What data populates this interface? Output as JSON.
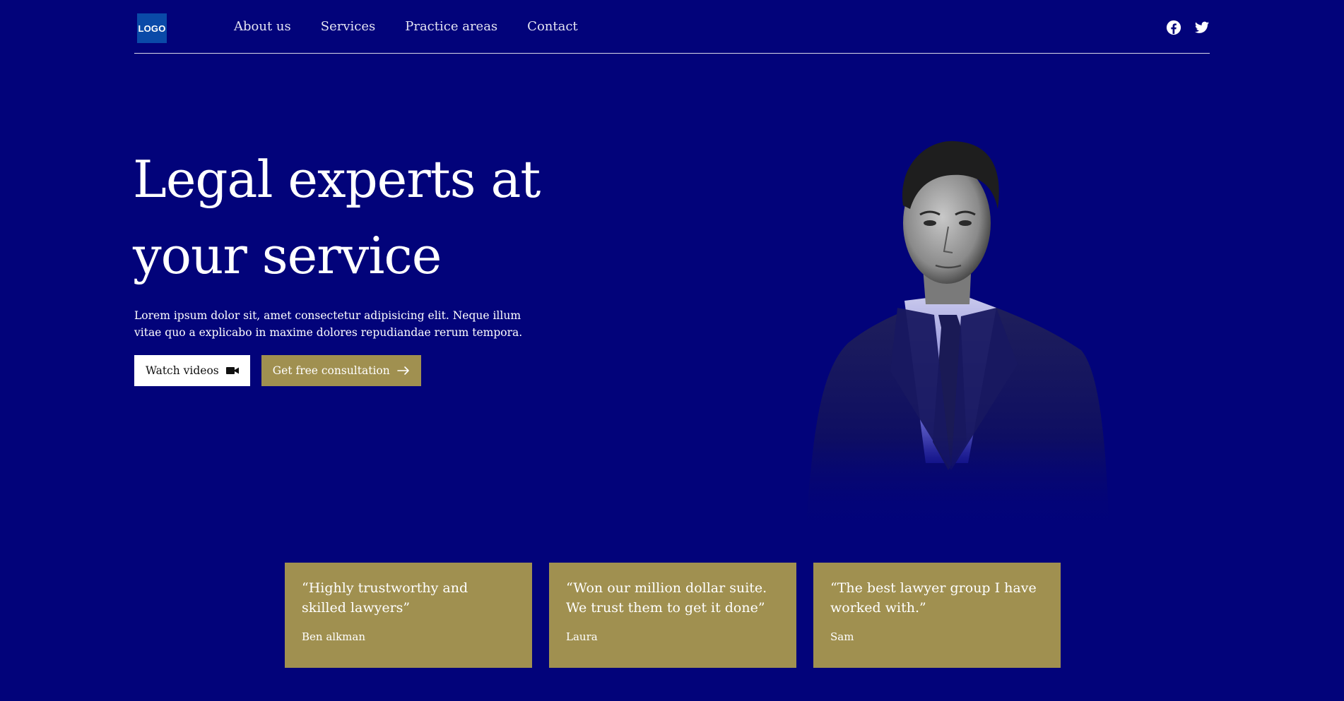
{
  "header": {
    "logo_text": "LOGO",
    "nav": [
      {
        "label": "About us"
      },
      {
        "label": "Services"
      },
      {
        "label": "Practice areas"
      },
      {
        "label": "Contact"
      }
    ],
    "social_icons": [
      "facebook-icon",
      "twitter-icon"
    ]
  },
  "hero": {
    "title_line1": "Legal experts at",
    "title_line2": "your service",
    "description": "Lorem ipsum dolor sit, amet consectetur adipisicing elit. Neque illum vitae quo a explicabo in maxime dolores repudiandae rerum tempora.",
    "watch_button": "Watch videos",
    "watch_icon": "video-camera-icon",
    "consult_button": "Get free consultation",
    "consult_icon": "arrow-right-icon"
  },
  "testimonials": [
    {
      "quote": "“Highly trustworthy and skilled lawyers”",
      "author": "Ben alkman"
    },
    {
      "quote": "“Won our million dollar suite. We trust them to get it done”",
      "author": "Laura"
    },
    {
      "quote": "“The best lawyer group I have worked with.”",
      "author": "Sam"
    }
  ],
  "colors": {
    "background": "#02037a",
    "accent_gold": "#a09050",
    "logo_blue": "#0a4aa8"
  }
}
